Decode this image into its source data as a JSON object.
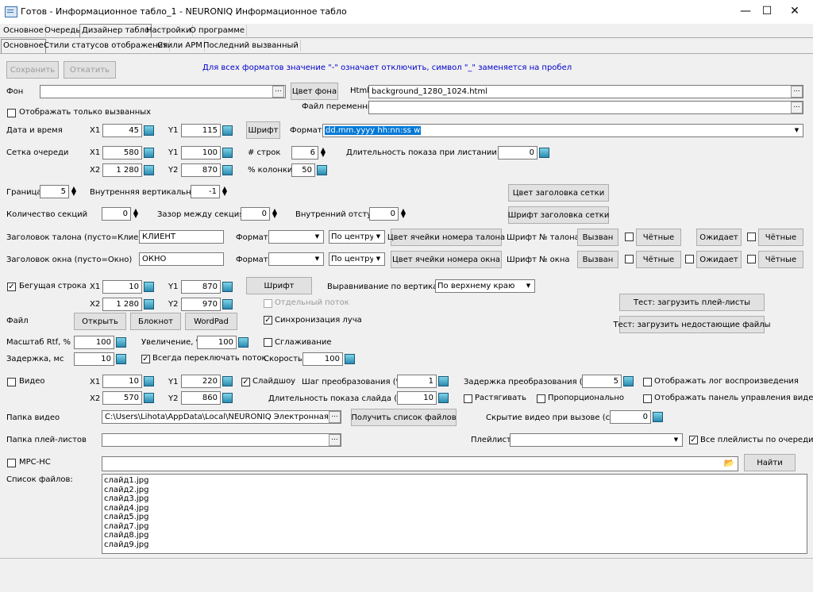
{
  "window": {
    "title": "Готов - Информационное табло_1 - NEURONIQ Информационное табло",
    "min": "—",
    "max": "☐",
    "close": "✕"
  },
  "tabs_main": [
    "Основное",
    "Очередь",
    "Дизайнер табло",
    "Настройки",
    "О программе"
  ],
  "tabs_sub": [
    "Основное",
    "Стили статусов отображения",
    "Стили АРМ",
    "Последний вызванный"
  ],
  "toolbar": {
    "save": "Сохранить",
    "revert": "Откатить",
    "note": "Для всех форматов значение \"-\" означает отключить, символ \"_\" заменяется на пробел"
  },
  "bg": {
    "label": "Фон",
    "value": "",
    "color_btn": "Цвет фона",
    "html_label": "Html",
    "html_value": "background_1280_1024.html",
    "vars_label": "Файл переменных",
    "vars_value": ""
  },
  "only_called": "Отображать только вызванных",
  "datetime": {
    "label": "Дата и время",
    "x1_label": "X1",
    "x1": "45",
    "y1_label": "Y1",
    "y1": "115",
    "font_btn": "Шрифт",
    "format_label": "Формат",
    "format": "dd.mm.yyyy hh:nn:ss w"
  },
  "grid": {
    "label": "Сетка очереди",
    "x1_label": "X1",
    "x1": "580",
    "y1_label": "Y1",
    "y1": "100",
    "rows_label": "# строк",
    "rows": "6",
    "dur_label": "Длительность показа при листании (сек)",
    "dur": "0",
    "x2_label": "X2",
    "x2": "1 280",
    "y2_label": "Y2",
    "y2": "870",
    "col_label": "% колонки",
    "col": "50"
  },
  "border": {
    "label": "Граница",
    "value": "5",
    "inner_label": "Внутренняя вертикальная",
    "inner": "-1",
    "header_color_btn": "Цвет заголовка сетки",
    "header_font_btn": "Шрифт заголовка сетки"
  },
  "sections": {
    "label": "Количество секций",
    "value": "0",
    "gap_label": "Зазор между секциями",
    "gap": "0",
    "pad_label": "Внутренний отступ",
    "pad": "0"
  },
  "ticket": {
    "label": "Заголовок талона (пусто=Клиент)",
    "value": "КЛИЕНТ",
    "format_label": "Формат",
    "format": "",
    "align": "По центру",
    "cell_color_btn": "Цвет ячейки номера талона",
    "font_label": "Шрифт № талона",
    "called_btn": "Вызван",
    "even1": "Чётные",
    "wait_btn": "Ожидает",
    "even2": "Чётные"
  },
  "window_hdr": {
    "label": "Заголовок окна (пусто=Окно)",
    "value": "ОКНО",
    "format_label": "Формат",
    "format": "",
    "align": "По центру",
    "cell_color_btn": "Цвет ячейки номера окна",
    "font_label": "Шрифт № окна",
    "called_btn": "Вызван",
    "even1": "Чётные",
    "wait_btn": "Ожидает",
    "even2": "Чётные"
  },
  "ticker": {
    "label": "Бегущая строка",
    "x1_label": "X1",
    "x1": "10",
    "y1_label": "Y1",
    "y1": "870",
    "font_btn": "Шрифт",
    "valign_label": "Выравнивание по вертикали",
    "valign": "По верхнему краю",
    "x2_label": "X2",
    "x2": "1 280",
    "y2_label": "Y2",
    "y2": "970",
    "sep_thread": "Отдельный поток",
    "test_playlists": "Тест: загрузить плей-листы",
    "test_missing": "Тест: загрузить недостающие файлы"
  },
  "file": {
    "label": "Файл",
    "open": "Открыть",
    "notepad": "Блокнот",
    "wordpad": "WordPad",
    "sync": "Синхронизация луча"
  },
  "scale": {
    "label": "Масштаб Rtf, %",
    "value": "100",
    "zoom_label": "Увеличение, %",
    "zoom": "100",
    "smooth": "Сглаживание"
  },
  "delay": {
    "label": "Задержка, мс",
    "value": "10",
    "always_restart": "Всегда переключать поток",
    "speed_label": "Скорость",
    "speed": "100"
  },
  "video": {
    "label": "Видео",
    "x1_label": "X1",
    "x1": "10",
    "y1_label": "Y1",
    "y1": "220",
    "slideshow": "Слайдшоу",
    "step_label": "Шаг преобразования (%)",
    "step": "1",
    "tdelay_label": "Задержка преобразования (мс)",
    "tdelay": "5",
    "show_log": "Отображать лог воспроизведения",
    "x2_label": "X2",
    "x2": "570",
    "y2_label": "Y2",
    "y2": "860",
    "slide_dur_label": "Длительность показа слайда (сек)",
    "slide_dur": "10",
    "stretch": "Растягивать",
    "proportional": "Пропорционально",
    "show_panel": "Отображать панель управления видео"
  },
  "video_folder": {
    "label": "Папка видео",
    "value": "C:\\Users\\Lihota\\AppData\\Local\\NEURONIQ Электронная очередь",
    "get_list": "Получить список файлов",
    "hide_label": "Скрытие видео при вызове (сек)",
    "hide": "0"
  },
  "playlist_folder": {
    "label": "Папка плей-листов",
    "value": "",
    "playlist_label": "Плейлист",
    "playlist": "",
    "all_playlists": "Все плейлисты по очереди"
  },
  "mpc": {
    "label": "MPC-HC",
    "value": "",
    "find": "Найти"
  },
  "files": {
    "label": "Список файлов:",
    "items": [
      "слайд1.jpg",
      "слайд2.jpg",
      "слайд3.jpg",
      "слайд4.jpg",
      "слайд5.jpg",
      "слайд7.jpg",
      "слайд8.jpg",
      "слайд9.jpg"
    ]
  }
}
